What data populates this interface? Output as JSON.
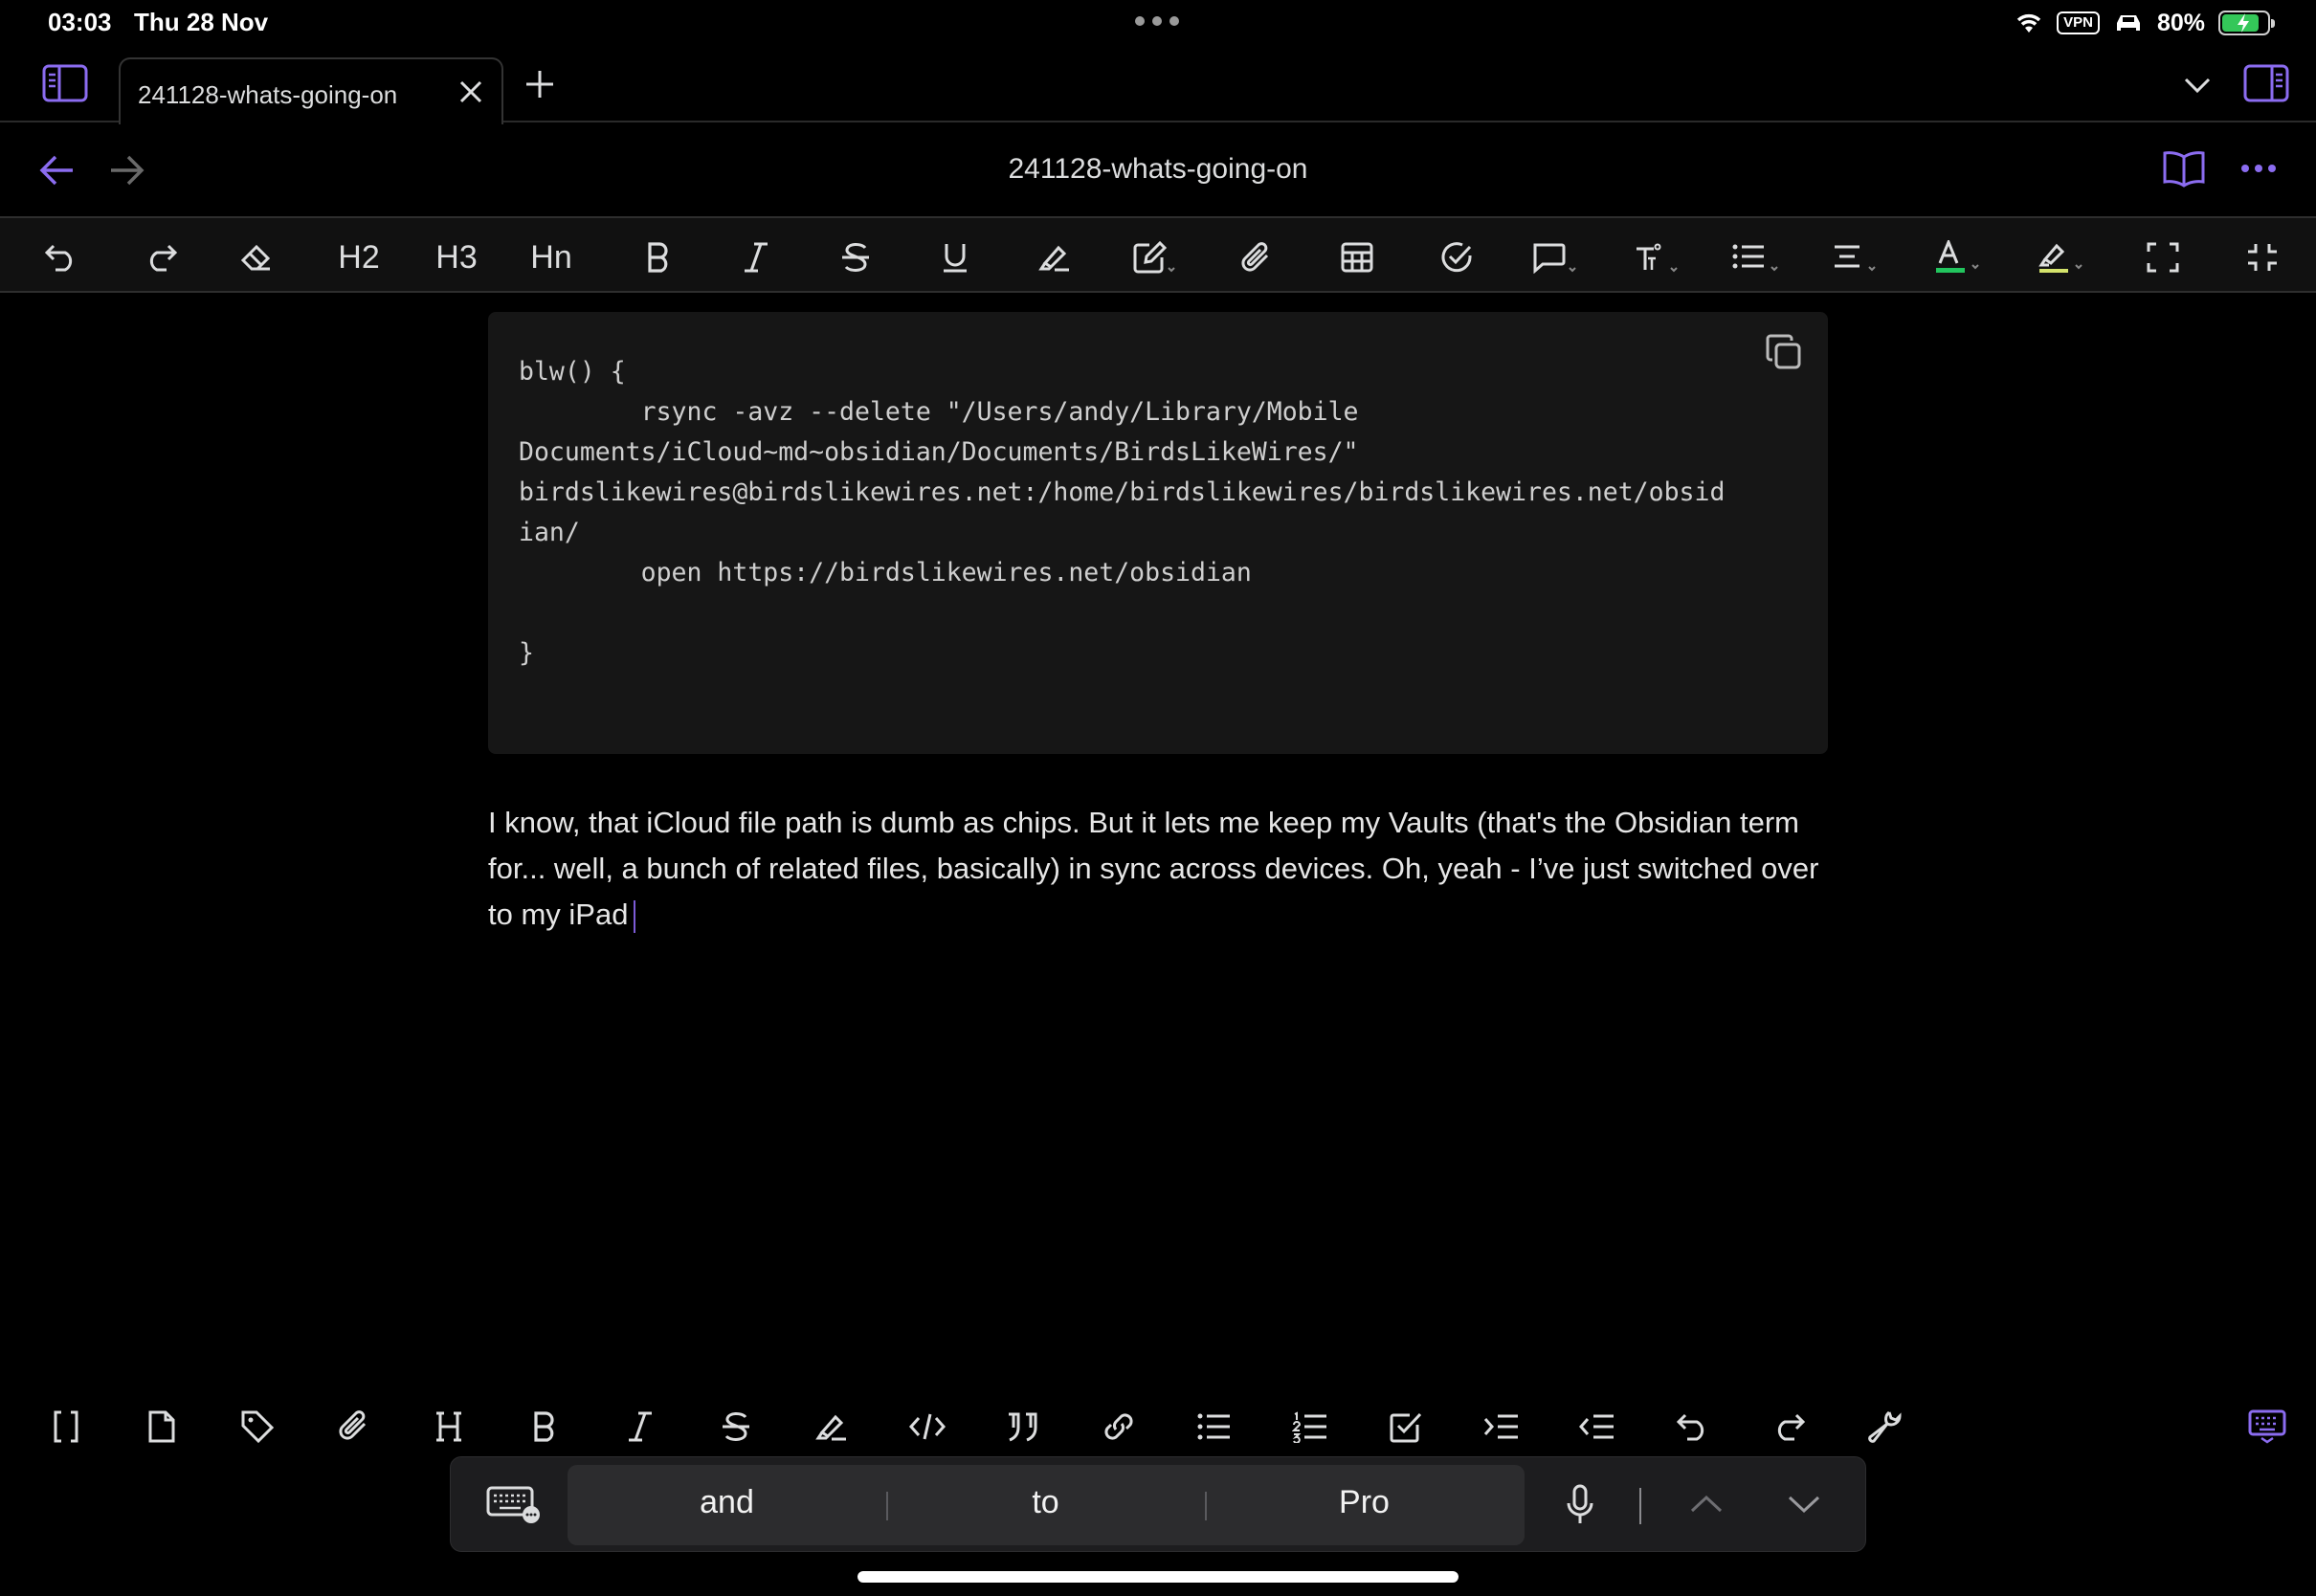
{
  "status": {
    "time": "03:03",
    "date": "Thu 28 Nov",
    "vpn": "VPN",
    "battery": "80%",
    "battery_level": 0.8
  },
  "tab": {
    "label": "241128-whats-going-on"
  },
  "document": {
    "title": "241128-whats-going-on"
  },
  "toolbar": {
    "h2": "H2",
    "h3": "H3",
    "hn": "Hn"
  },
  "code_block": {
    "text": "blw() {\n        rsync -avz --delete \"/Users/andy/Library/Mobile\nDocuments/iCloud~md~obsidian/Documents/BirdsLikeWires/\"\nbirdslikewires@birdslikewires.net:/home/birdslikewires/birdslikewires.net/obsid\nian/\n        open https://birdslikewires.net/obsidian\n\n}"
  },
  "paragraph": {
    "text": "I know, that iCloud file path is dumb as chips. But it lets me keep my Vaults (that's the Obsidian term for... well, a bunch of related files, basically) in sync across devices. Oh, yeah - I’ve just switched over to my iPad"
  },
  "keyboard": {
    "suggestions": [
      "and",
      "to",
      "Pro"
    ]
  },
  "colors": {
    "accent": "#8b6cf0",
    "background": "#000000",
    "code_bg": "#161616",
    "toolbar_bg": "#111111",
    "text_color_underline": "#22c55e"
  }
}
